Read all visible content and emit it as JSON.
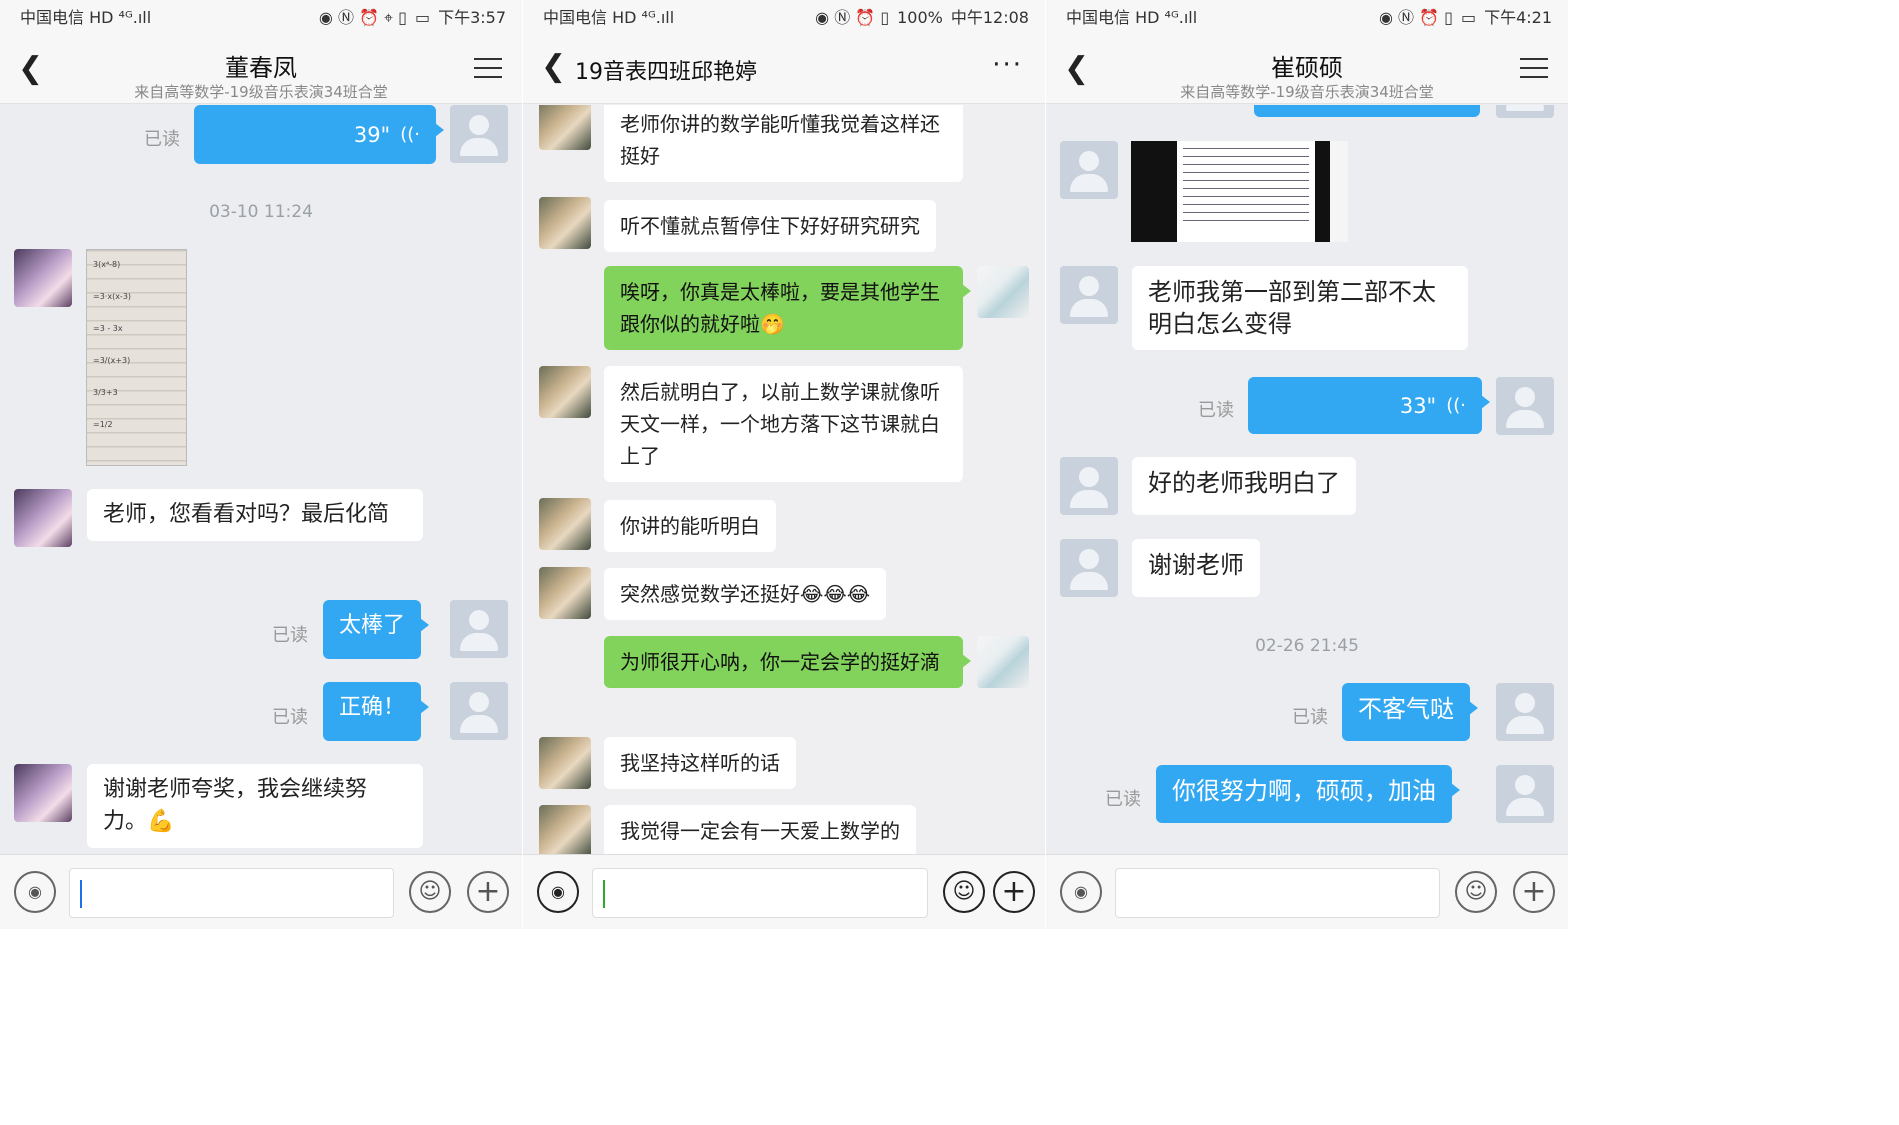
{
  "panel1": {
    "status": {
      "carrier": "中国电信",
      "net": "HD ⁴ᴳ.ıll",
      "icons": "◉ Ⓝ ⏰ ⌖ ▯",
      "battery": "▭",
      "time": "下午3:57"
    },
    "title": "董春凤",
    "subtitle": "来自高等数学-19级音乐表演34班合堂",
    "messages": {
      "voice_duration": "39\"",
      "read1": "已读",
      "timestamp": "03-10 11:24",
      "paper_lines": [
        "3(x⁴-8)",
        "=3·x(x-3)",
        "=3 - 3x",
        "=3/(x+3)",
        "3/3+3",
        "=1/2"
      ],
      "m1": "老师，您看看对吗？最后化简",
      "read2": "已读",
      "m2": "太棒了",
      "read3": "已读",
      "m3": "正确！",
      "m4": "谢谢老师夸奖，我会继续努力。💪"
    }
  },
  "panel2": {
    "status": {
      "carrier": "中国电信",
      "net": "HD ⁴ᴳ.ıll",
      "icons": "◉ Ⓝ ⏰ ▯",
      "battery": "100%",
      "time": "中午12:08"
    },
    "title": "19音表四班邱艳婷",
    "more": "···",
    "messages": {
      "m1": "老师你讲的数学能听懂我觉着这样还挺好",
      "m2": "听不懂就点暂停住下好好研究研究",
      "m3": "唉呀，你真是太棒啦，要是其他学生跟你似的就好啦🤭",
      "m4": "然后就明白了，以前上数学课就像听天文一样，一个地方落下这节课就白上了",
      "m5": "你讲的能听明白",
      "m6": "突然感觉数学还挺好😂😂😂",
      "m7": "为师很开心呐，你一定会学的挺好滴",
      "m8": "我坚持这样听的话",
      "m9": "我觉得一定会有一天爱上数学的"
    }
  },
  "panel3": {
    "status": {
      "carrier": "中国电信",
      "net": "HD ⁴ᴳ.ıll",
      "icons": "◉ Ⓝ ⏰ ▯",
      "battery": "▭",
      "time": "下午4:21"
    },
    "title": "崔硕硕",
    "subtitle": "来自高等数学-19级音乐表演34班合堂",
    "messages": {
      "m1": "老师我第一部到第二部不太明白怎么变得",
      "read1": "已读",
      "voice_duration": "33\"",
      "m2": "好的老师我明白了",
      "m3": "谢谢老师",
      "timestamp": "02-26 21:45",
      "read2": "已读",
      "m4": "不客气哒",
      "read3": "已读",
      "m5": "你很努力啊，硕硕，加油"
    }
  },
  "input": {
    "voice_icon": "🔊",
    "emoji_icon": "☺",
    "plus_icon": "+"
  },
  "colors": {
    "out_bubble": "#33a8f2",
    "green_bubble": "#82d35b",
    "in_bubble": "#ffffff",
    "background": "#ebedf0"
  }
}
